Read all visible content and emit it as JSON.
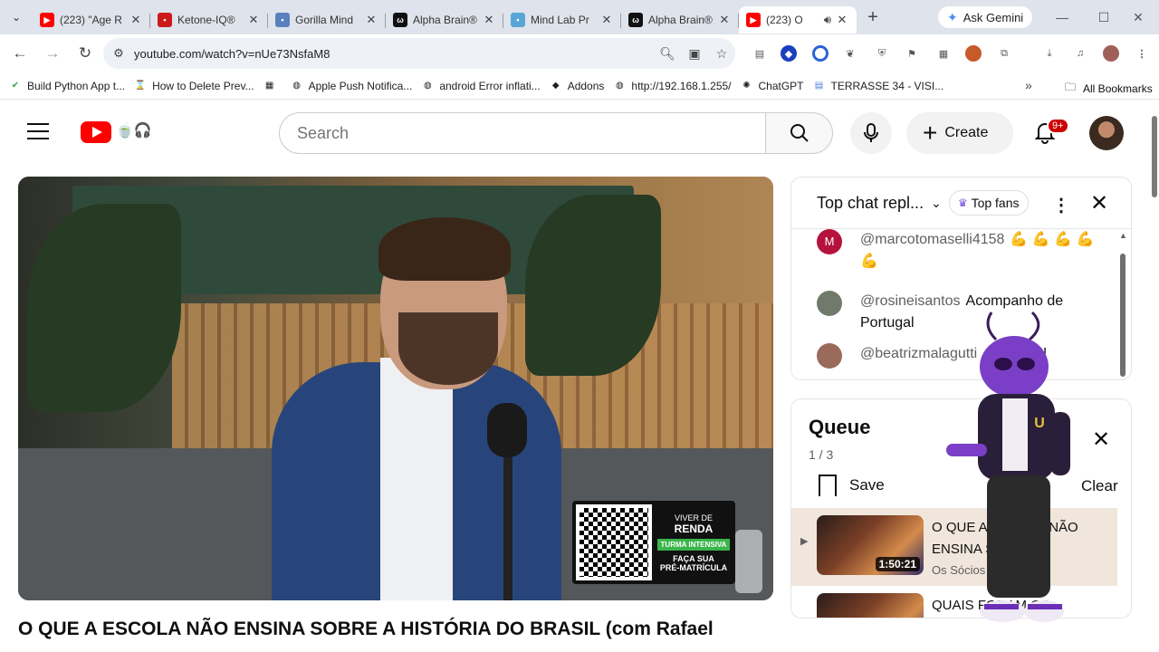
{
  "browser": {
    "tabs": [
      {
        "title": "(223) \"Age R",
        "icon": "youtube-icon",
        "color": "#ff0000"
      },
      {
        "title": "Ketone-IQ®",
        "icon": "opera-icon",
        "color": "#cc1a1a"
      },
      {
        "title": "Gorilla Mind",
        "icon": "gorilla-icon",
        "color": "#5a7fbf"
      },
      {
        "title": "Alpha Brain®",
        "icon": "onnit-icon",
        "color": "#111111"
      },
      {
        "title": "Mind Lab Pr",
        "icon": "mindlab-icon",
        "color": "#58a6d6"
      },
      {
        "title": "Alpha Brain®",
        "icon": "onnit-icon",
        "color": "#111111"
      },
      {
        "title": "(223) O",
        "icon": "youtube-icon",
        "color": "#ff0000",
        "active": true
      }
    ],
    "gemini_label": "Ask Gemini",
    "url": "youtube.com/watch?v=nUe73NsfaM8",
    "bookmarks": [
      {
        "label": "Build Python App t...",
        "icon": "green-check-icon"
      },
      {
        "label": "How to Delete Prev...",
        "icon": "hourglass-icon"
      },
      {
        "label": "",
        "icon": "apps-grid-icon"
      },
      {
        "label": "Apple Push Notifica...",
        "icon": "globe-icon"
      },
      {
        "label": "android Error inflati...",
        "icon": "globe-icon"
      },
      {
        "label": "Addons",
        "icon": "diamond-icon"
      },
      {
        "label": "http://192.168.1.255/",
        "icon": "globe-icon"
      },
      {
        "label": "ChatGPT",
        "icon": "chatgpt-icon"
      },
      {
        "label": "TERRASSE 34 - VISI...",
        "icon": "doc-icon"
      }
    ],
    "all_bookmarks_label": "All Bookmarks"
  },
  "youtube": {
    "search_placeholder": "Search",
    "create_label": "Create",
    "notif_badge": "9+",
    "video_title": "O QUE A ESCOLA NÃO ENSINA SOBRE A HISTÓRIA DO BRASIL (com Rafael"
  },
  "video_overlay": {
    "brand_top": "VIVER DE",
    "brand": "RENDA",
    "tag": "TURMA INTENSIVA",
    "cta_line1": "FAÇA SUA",
    "cta_line2": "PRÉ-MATRÍCULA"
  },
  "chat": {
    "mode_label": "Top chat repl...",
    "top_fans_label": "Top fans",
    "messages": [
      {
        "user": "@marcotomaselli4158",
        "text": "💪 💪 💪 💪 💪",
        "avatar_letter": "M",
        "avatar_color": "#b5123d"
      },
      {
        "user": "@rosineisantos",
        "text": "Acompanho de Portugal",
        "avatar_letter": "",
        "avatar_color": "#6f7a6a"
      },
      {
        "user": "@beatrizmalagutti",
        "text": "...ma top!!",
        "avatar_letter": "",
        "avatar_color": "#9a6a5a"
      }
    ]
  },
  "queue": {
    "title": "Queue",
    "count": "1 / 3",
    "save_label": "Save",
    "clear_label": "Clear",
    "items": [
      {
        "title": "O QUE A ESCOLA NÃO ENSINA SOBRE...",
        "channel": "Os Sócios Podcast",
        "duration": "1:50:21",
        "active": true
      },
      {
        "title": "QUAIS FORAM OS...",
        "channel": "",
        "duration": "",
        "active": false
      }
    ]
  }
}
